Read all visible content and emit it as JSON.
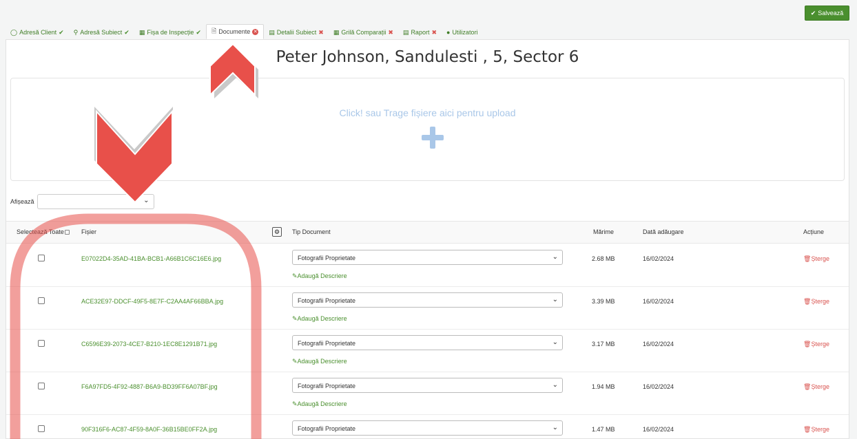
{
  "toolbar": {
    "save_label": "Salvează"
  },
  "tabs": [
    {
      "label": "Adresă Client",
      "status": "ok"
    },
    {
      "label": "Adresă Subiect",
      "status": "ok"
    },
    {
      "label": "Fișa de Inspecție",
      "status": "ok"
    },
    {
      "label": "Documente",
      "status": "error"
    },
    {
      "label": "Detalii Subiect",
      "status": "bad"
    },
    {
      "label": "Grilă Comparații",
      "status": "bad"
    },
    {
      "label": "Raport",
      "status": "bad"
    },
    {
      "label": "Utilizatori",
      "status": "none"
    }
  ],
  "page": {
    "title": "Peter Johnson, Sandulesti , 5, Sector 6"
  },
  "dropzone": {
    "text": "Click! sau Trage fișiere aici pentru upload"
  },
  "filter": {
    "label": "Afișează",
    "value": ""
  },
  "table": {
    "headers": {
      "select_all": "Selectează Toate",
      "file": "Fișier",
      "doc_type": "Tip Document",
      "size": "Mărime",
      "date": "Dată adăugare",
      "action": "Acțiune"
    },
    "add_description_label": "Adaugă Descriere",
    "delete_label": "Șterge",
    "rows": [
      {
        "file": "E07022D4-35AD-41BA-BCB1-A66B1C6C16E6.jpg",
        "type": "Fotografii Proprietate",
        "size": "2.68 MB",
        "date": "16/02/2024"
      },
      {
        "file": "ACE32E97-DDCF-49F5-8E7F-C2AA4AF66BBA.jpg",
        "type": "Fotografii Proprietate",
        "size": "3.39 MB",
        "date": "16/02/2024"
      },
      {
        "file": "C6596E39-2073-4CE7-B210-1EC8E1291B71.jpg",
        "type": "Fotografii Proprietate",
        "size": "3.17 MB",
        "date": "16/02/2024"
      },
      {
        "file": "F6A97FD5-4F92-4887-B6A9-BD39FF6A07BF.jpg",
        "type": "Fotografii Proprietate",
        "size": "1.94 MB",
        "date": "16/02/2024"
      },
      {
        "file": "90F316F6-AC87-4F59-8A0F-36B15BE0FF2A.jpg",
        "type": "Fotografii Proprietate",
        "size": "1.47 MB",
        "date": "16/02/2024"
      }
    ]
  },
  "colors": {
    "accent": "#4a8f2e",
    "danger": "#d9534f",
    "annotation": "#e8504a",
    "dropzone_text": "#a9c7e8"
  }
}
